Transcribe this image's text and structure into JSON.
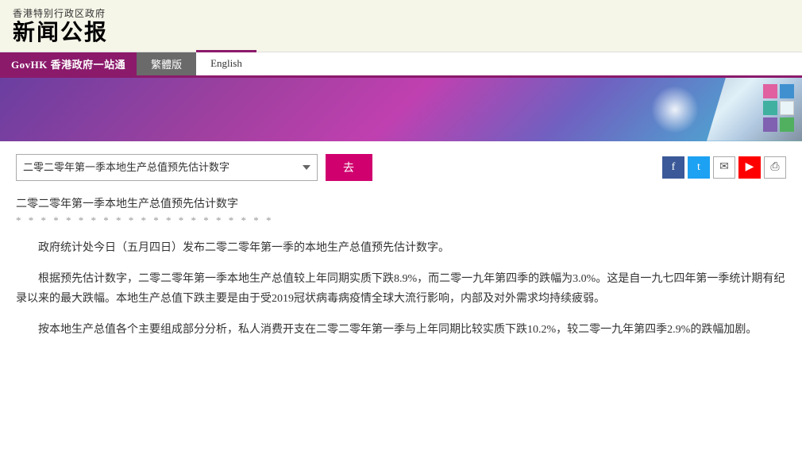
{
  "header": {
    "subtitle": "香港特别行政区政府",
    "title": "新闻公报"
  },
  "nav": {
    "govhk_label": "GovHK 香港政府一站通",
    "trad_label": "繁體版",
    "english_label": "English"
  },
  "toolbar": {
    "dropdown_value": "二零二零年第一季本地生产总值预先估计数字",
    "go_label": "去"
  },
  "social": {
    "fb": "f",
    "tw": "t",
    "mail": "✉",
    "yt": "▶",
    "print": "⎙"
  },
  "article": {
    "title": "二零二零年第一季本地生产总值预先估计数字",
    "divider": "* * * * * * * * * * * * * * * * * * * * *",
    "para1": "政府统计处今日（五月四日）发布二零二零年第一季的本地生产总值预先估计数字。",
    "para2": "根据预先估计数字，二零二零年第一季本地生产总值较上年同期实质下跌8.9%，而二零一九年第四季的跌幅为3.0%。这是自一九七四年第一季统计期有纪录以来的最大跌幅。本地生产总值下跌主要是由于受2019冠状病毒病疫情全球大流行影响，内部及对外需求均持续疲弱。",
    "para3": "按本地生产总值各个主要组成部分分析，私人消费开支在二零二零年第一季与上年同期比较实质下跌10.2%，较二零一九年第四季2.9%的跌幅加剧。"
  }
}
